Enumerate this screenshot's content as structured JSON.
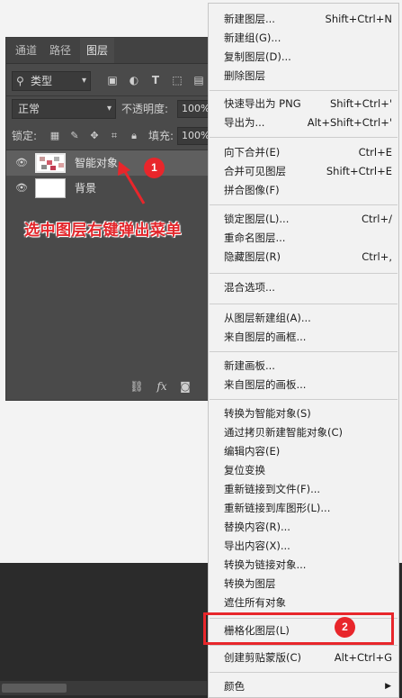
{
  "layers_panel": {
    "tabs": [
      "通道",
      "路径",
      "图层"
    ],
    "active_tab": "图层",
    "filter_kind": "类型",
    "blend_mode": "正常",
    "opacity_label": "不透明度:",
    "opacity_value": "100%",
    "lock_label": "锁定:",
    "fill_label": "填充:",
    "fill_value": "100%",
    "layers": [
      {
        "name": "智能对象",
        "selected": true,
        "thumb": "smart-object"
      },
      {
        "name": "背景",
        "selected": false,
        "thumb": "white"
      }
    ],
    "footer_icons": [
      "link-icon",
      "fx-icon",
      "mask-icon"
    ]
  },
  "context_menu": {
    "items": [
      {
        "label": "新建图层...",
        "shortcut": "Shift+Ctrl+N"
      },
      {
        "label": "新建组(G)...",
        "shortcut": ""
      },
      {
        "label": "复制图层(D)...",
        "shortcut": ""
      },
      {
        "label": "删除图层",
        "shortcut": ""
      },
      {
        "label": "快速导出为 PNG",
        "shortcut": "Shift+Ctrl+'"
      },
      {
        "label": "导出为...",
        "shortcut": "Alt+Shift+Ctrl+'"
      },
      {
        "label": "向下合并(E)",
        "shortcut": "Ctrl+E"
      },
      {
        "label": "合并可见图层",
        "shortcut": "Shift+Ctrl+E"
      },
      {
        "label": "拼合图像(F)",
        "shortcut": ""
      },
      {
        "label": "锁定图层(L)...",
        "shortcut": "Ctrl+/"
      },
      {
        "label": "重命名图层...",
        "shortcut": ""
      },
      {
        "label": "隐藏图层(R)",
        "shortcut": "Ctrl+,"
      },
      {
        "label": "混合选项...",
        "shortcut": ""
      },
      {
        "label": "从图层新建组(A)...",
        "shortcut": ""
      },
      {
        "label": "来自图层的画框...",
        "shortcut": ""
      },
      {
        "label": "新建画板...",
        "shortcut": ""
      },
      {
        "label": "来自图层的画板...",
        "shortcut": ""
      },
      {
        "label": "转换为智能对象(S)",
        "shortcut": ""
      },
      {
        "label": "通过拷贝新建智能对象(C)",
        "shortcut": ""
      },
      {
        "label": "编辑内容(E)",
        "shortcut": ""
      },
      {
        "label": "复位变换",
        "shortcut": ""
      },
      {
        "label": "重新链接到文件(F)...",
        "shortcut": ""
      },
      {
        "label": "重新链接到库图形(L)...",
        "shortcut": ""
      },
      {
        "label": "替换内容(R)...",
        "shortcut": ""
      },
      {
        "label": "导出内容(X)...",
        "shortcut": ""
      },
      {
        "label": "转换为链接对象...",
        "shortcut": ""
      },
      {
        "label": "转换为图层",
        "shortcut": ""
      },
      {
        "label": "遮住所有对象",
        "shortcut": ""
      },
      {
        "label": "栅格化图层(L)",
        "shortcut": ""
      },
      {
        "label": "创建剪贴蒙版(C)",
        "shortcut": "Alt+Ctrl+G"
      },
      {
        "label": "颜色",
        "shortcut": ""
      }
    ]
  },
  "annotations": {
    "instruction": "选中图层右键弹出菜单",
    "badge_1": "1",
    "badge_2": "2",
    "accent_color": "#e8262b"
  }
}
